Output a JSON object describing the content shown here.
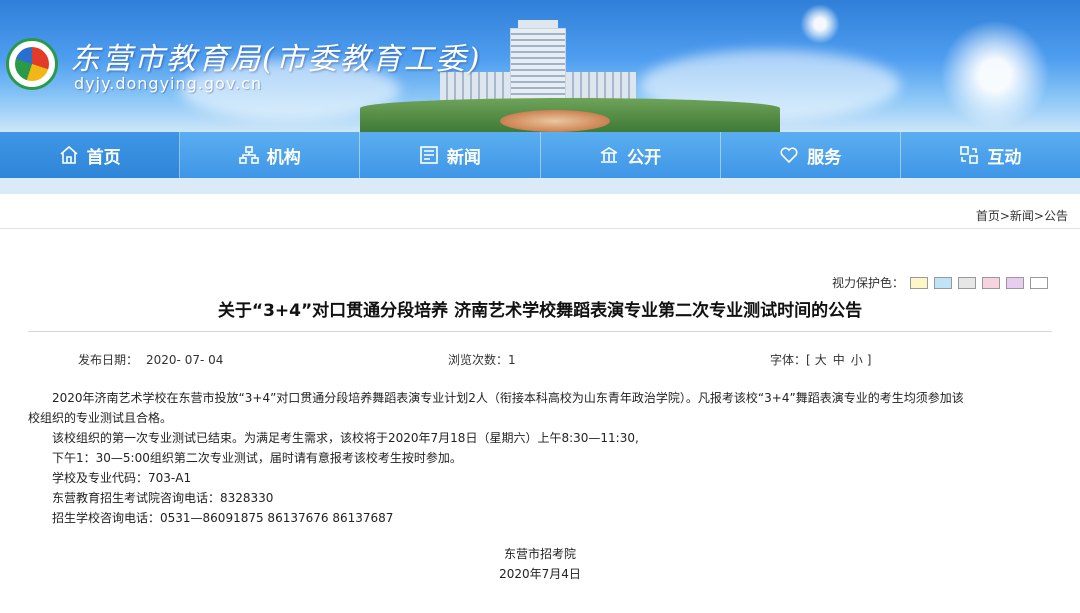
{
  "header": {
    "site_name": "东营市教育局(市委教育工委)",
    "domain": "dyjy.dongying.gov.cn",
    "logo_icon": "education-emblem-icon"
  },
  "nav": {
    "items": [
      {
        "label": "首页",
        "icon": "home-icon"
      },
      {
        "label": "机构",
        "icon": "org-chart-icon"
      },
      {
        "label": "新闻",
        "icon": "news-icon"
      },
      {
        "label": "公开",
        "icon": "public-icon"
      },
      {
        "label": "服务",
        "icon": "heart-icon"
      },
      {
        "label": "互动",
        "icon": "interaction-icon"
      }
    ]
  },
  "breadcrumb": "首页>新闻>公告",
  "vision": {
    "label": "视力保护色：",
    "swatches": [
      "#fdf7c8",
      "#bfe3f7",
      "#e6e6e6",
      "#f7d3df",
      "#e8cdf0",
      "#ffffff"
    ]
  },
  "article": {
    "title": "关于“3+4”对口贯通分段培养 济南艺术学校舞蹈表演专业第二次专业测试时间的公告",
    "date_label": "发布日期：",
    "date_value": "2020- 07- 04",
    "views_label": "浏览次数：",
    "views_value": "1",
    "font_label": "字体：",
    "font_open": "[",
    "font_large": "大",
    "font_medium": "中",
    "font_small": "小",
    "font_close": "]",
    "paragraphs": [
      "2020年济南艺术学校在东营市投放“3+4”对口贯通分段培养舞蹈表演专业计划2人（衔接本科高校为山东青年政治学院）。凡报考该校“3+4”舞蹈表演专业的考生均须参加该",
      "校组织的专业测试且合格。",
      "该校组织的第一次专业测试已结束。为满足考生需求，该校将于2020年7月18日（星期六）上午8:30—11:30,",
      "下午1：30—5:00组织第二次专业测试，届时请有意报考该校考生按时参加。",
      "学校及专业代码：703-A1",
      "东营教育招生考试院咨询电话：8328330",
      "招生学校咨询电话：0531—86091875  86137676  86137687"
    ],
    "signature": "东营市招考院",
    "sign_date": "2020年7月4日"
  },
  "colors": {
    "nav_bg": "#4fa3ec",
    "nav_active": "#3388dc"
  }
}
